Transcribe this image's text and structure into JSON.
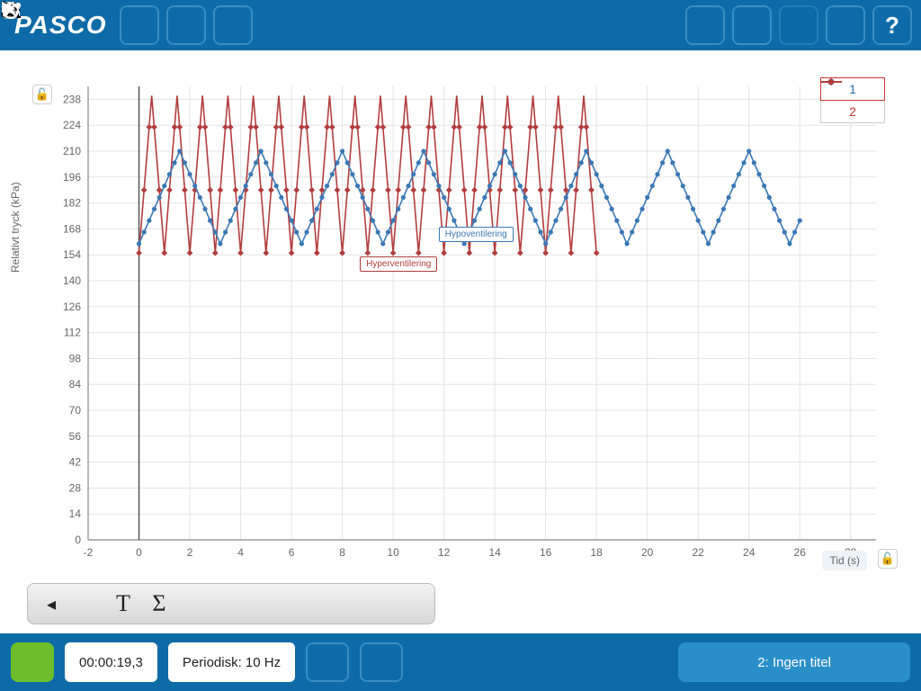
{
  "topbar": {
    "logo": "PASCO"
  },
  "legend": {
    "series1": "1",
    "series2": "2"
  },
  "axes": {
    "ylabel": "Relativt tryck (kPa)",
    "xlabel": "Tid (s)"
  },
  "annotations": {
    "hyper": "Hyperventilering",
    "hypo": "Hypoventilering"
  },
  "bottombar": {
    "time": "00:00:19,3",
    "sampling": "Periodisk: 10 Hz",
    "run": "2: Ingen titel"
  },
  "colors": {
    "accent": "#0e6ba8",
    "series1": "#3a78b5",
    "series2": "#b33d3d",
    "play": "#6cbf2a"
  },
  "chart_data": {
    "type": "line",
    "xlabel": "Tid (s)",
    "ylabel": "Relativt tryck (kPa)",
    "xlim": [
      -2,
      29
    ],
    "ylim": [
      0,
      245
    ],
    "xticks": [
      -2,
      0,
      2,
      4,
      6,
      8,
      10,
      12,
      14,
      16,
      18,
      20,
      22,
      24,
      26,
      28
    ],
    "yticks": [
      0,
      14,
      28,
      42,
      56,
      70,
      84,
      98,
      112,
      126,
      140,
      154,
      168,
      182,
      196,
      210,
      224,
      238
    ],
    "series": [
      {
        "name": "1",
        "color": "#3a78b5",
        "x_range": [
          0,
          26
        ],
        "description": "Hypoventilering — slow breathing wave",
        "period_s": 3.2,
        "low_kPa": 160,
        "high_kPa": 210,
        "n_cycles": 8
      },
      {
        "name": "2",
        "color": "#b33d3d",
        "x_range": [
          0,
          18
        ],
        "description": "Hyperventilering — fast breathing wave",
        "period_s": 1.0,
        "low_kPa": 155,
        "high_kPa": 240,
        "n_cycles": 18
      }
    ],
    "annotations": [
      {
        "text": "Hyperventilering",
        "x": 8.2,
        "y": 160,
        "color": "#b33d3d"
      },
      {
        "text": "Hypoventilering",
        "x": 11.2,
        "y": 181,
        "color": "#3a78b5"
      }
    ]
  }
}
